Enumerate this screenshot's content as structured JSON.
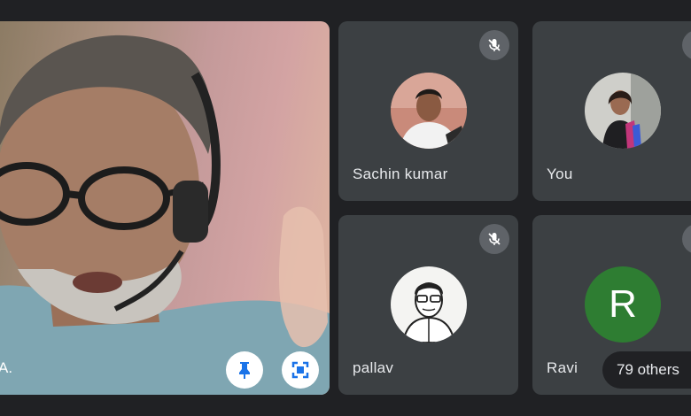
{
  "main_video": {
    "participant_name": "A.",
    "pin_icon": "pin-icon",
    "fullscreen_icon": "fullscreen-icon"
  },
  "tiles": [
    {
      "name": "Sachin kumar",
      "muted": true,
      "avatar_type": "photo"
    },
    {
      "name": "You",
      "muted": true,
      "avatar_type": "photo"
    },
    {
      "name": "pallav",
      "muted": true,
      "avatar_type": "sketch"
    },
    {
      "name": "Ravi",
      "muted": true,
      "avatar_type": "letter",
      "avatar_letter": "R",
      "avatar_color": "#2e7d32"
    }
  ],
  "others_chip": {
    "label": "79 others"
  },
  "colors": {
    "background": "#202124",
    "tile": "#3c4043",
    "mute_badge": "#5f6368"
  }
}
